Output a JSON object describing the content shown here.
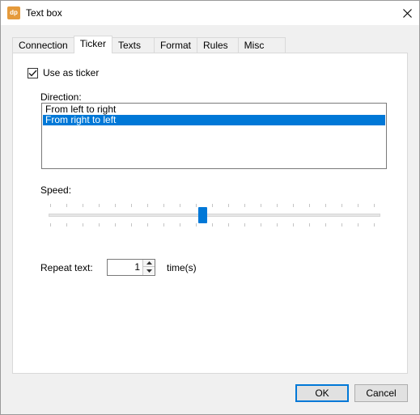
{
  "window": {
    "title": "Text box",
    "app_icon_text": "dp"
  },
  "tabs": [
    {
      "label": "Connection"
    },
    {
      "label": "Ticker",
      "active": true
    },
    {
      "label": "Texts"
    },
    {
      "label": "Format"
    },
    {
      "label": "Rules"
    },
    {
      "label": "Misc"
    }
  ],
  "ticker": {
    "use_as_ticker_label": "Use as ticker",
    "use_as_ticker_checked": true,
    "direction_label": "Direction:",
    "direction_options": [
      {
        "label": "From left to right",
        "selected": false
      },
      {
        "label": "From right to left",
        "selected": true
      }
    ],
    "speed_label": "Speed:",
    "speed_tick_count": 21,
    "speed_value_fraction": 0.47,
    "repeat_label": "Repeat text:",
    "repeat_value": "1",
    "times_label": "time(s)"
  },
  "buttons": {
    "ok_label": "OK",
    "cancel_label": "Cancel"
  },
  "colors": {
    "accent": "#0078d7",
    "app_icon": "#e59a3b"
  }
}
